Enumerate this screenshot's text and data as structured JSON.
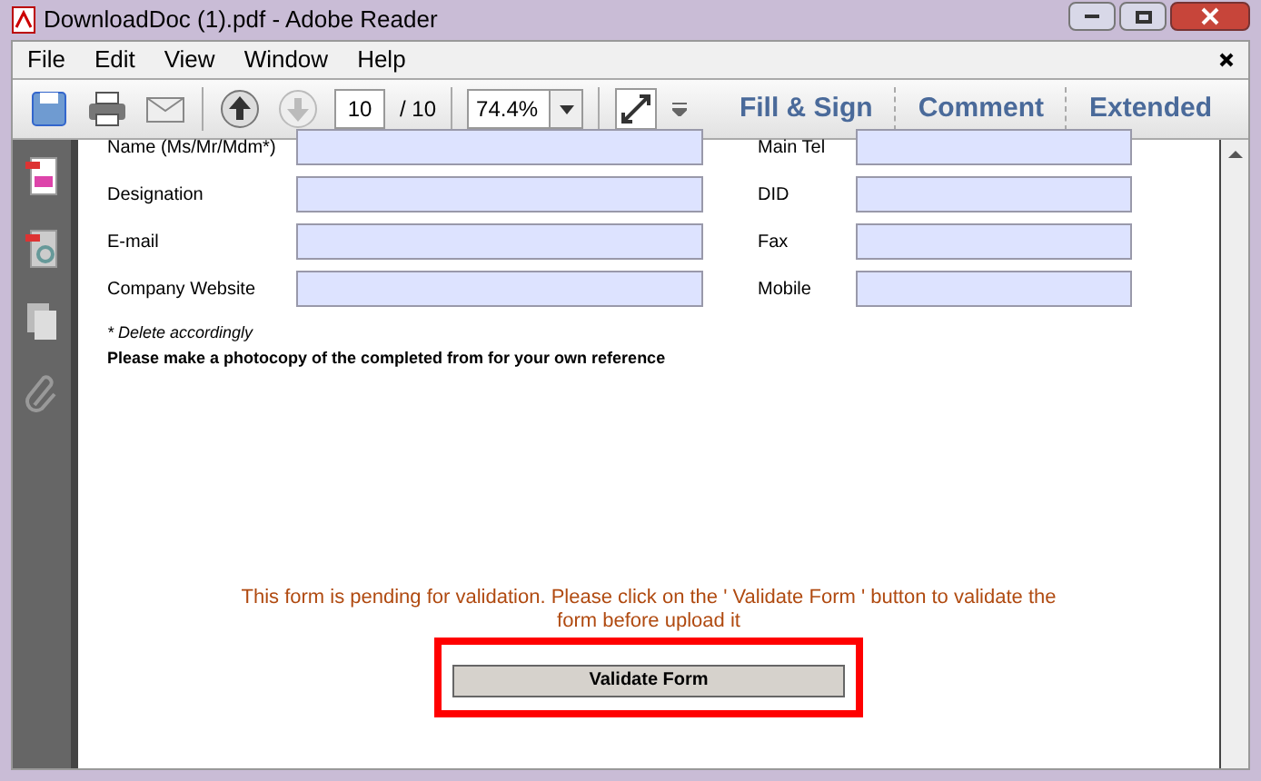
{
  "window": {
    "title": "DownloadDoc (1).pdf - Adobe Reader"
  },
  "menu": [
    "File",
    "Edit",
    "View",
    "Window",
    "Help"
  ],
  "toolbar": {
    "page": "10",
    "page_total": "/ 10",
    "zoom": "74.4%",
    "panels": [
      "Fill & Sign",
      "Comment",
      "Extended"
    ]
  },
  "form": {
    "rows": [
      {
        "left_label": "Name (Ms/Mr/Mdm*)",
        "right_label": "Main Tel"
      },
      {
        "left_label": "Designation",
        "right_label": "DID"
      },
      {
        "left_label": "E-mail",
        "right_label": "Fax"
      },
      {
        "left_label": "Company Website",
        "right_label": "Mobile"
      }
    ],
    "footnote": "* Delete accordingly",
    "note": "Please make a photocopy of the completed from for your own reference",
    "validation_message": "This form is pending for validation. Please click on the ' Validate Form ' button to validate the form before upload it",
    "validate_button": "Validate Form",
    "button_highlighted": true
  }
}
